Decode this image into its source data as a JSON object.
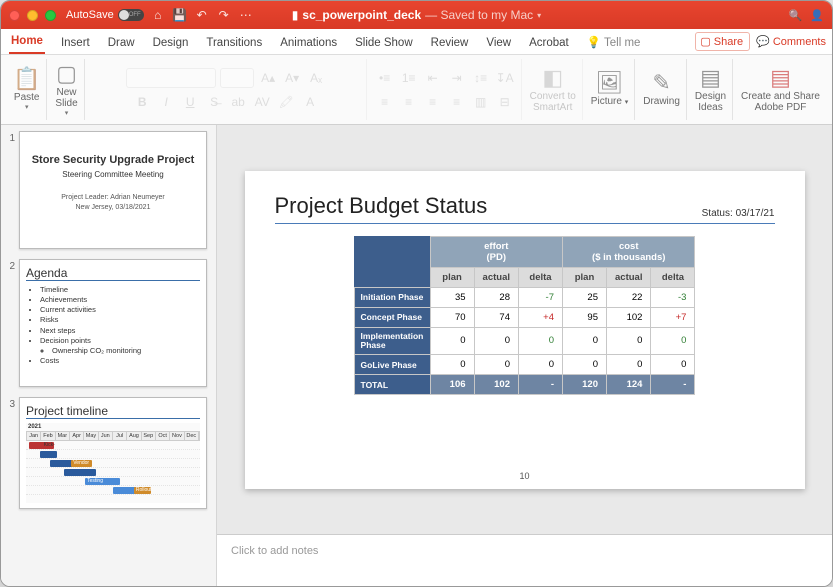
{
  "titlebar": {
    "autosave_label": "AutoSave",
    "autosave_state": "OFF",
    "filename": "sc_powerpoint_deck",
    "saved_text": "— Saved to my Mac"
  },
  "tabs": {
    "home": "Home",
    "insert": "Insert",
    "draw": "Draw",
    "design": "Design",
    "transitions": "Transitions",
    "animations": "Animations",
    "slideshow": "Slide Show",
    "review": "Review",
    "view": "View",
    "acrobat": "Acrobat",
    "tellme": "Tell me",
    "share": "Share",
    "comments": "Comments"
  },
  "ribbon": {
    "paste": "Paste",
    "newslide": "New\nSlide",
    "convert": "Convert to\nSmartArt",
    "picture": "Picture",
    "drawing": "Drawing",
    "designideas": "Design\nIdeas",
    "adobe": "Create and Share\nAdobe PDF"
  },
  "thumbs": {
    "s1": {
      "title": "Store Security Upgrade Project",
      "subtitle": "Steering Committee Meeting",
      "leader": "Project Leader: Adrian Neumeyer",
      "loc": "New Jersey, 03/18/2021"
    },
    "s2": {
      "title": "Agenda",
      "items": [
        "Timeline",
        "Achievements",
        "Current activities",
        "Risks",
        "Next steps",
        "Decision points",
        "Costs"
      ],
      "subitem": "Ownership CO₂ monitoring"
    },
    "s3": {
      "title": "Project timeline",
      "year": "2021",
      "months": [
        "Jan",
        "Feb",
        "Mar",
        "Apr",
        "May",
        "Jun",
        "Jul",
        "Aug",
        "Sep",
        "Oct",
        "Nov",
        "Dec"
      ]
    }
  },
  "slide": {
    "title": "Project Budget Status",
    "status_label": "Status:",
    "status_date": "03/17/21",
    "grp_effort": "effort\n(PD)",
    "grp_cost": "cost\n($ in thousands)",
    "cols": {
      "plan": "plan",
      "actual": "actual",
      "delta": "delta"
    },
    "rows": [
      {
        "name": "Initiation Phase",
        "eplan": "35",
        "eact": "28",
        "edelta": "-7",
        "cplan": "25",
        "cact": "22",
        "cdelta": "-3"
      },
      {
        "name": "Concept Phase",
        "eplan": "70",
        "eact": "74",
        "edelta": "+4",
        "cplan": "95",
        "cact": "102",
        "cdelta": "+7"
      },
      {
        "name": "Implementation Phase",
        "eplan": "0",
        "eact": "0",
        "edelta": "0",
        "cplan": "0",
        "cact": "0",
        "cdelta": "0"
      },
      {
        "name": "GoLive Phase",
        "eplan": "0",
        "eact": "0",
        "edelta": "0",
        "cplan": "0",
        "cact": "0",
        "cdelta": "0"
      }
    ],
    "total": {
      "name": "TOTAL",
      "eplan": "106",
      "eact": "102",
      "edelta": "-",
      "cplan": "120",
      "cact": "124",
      "cdelta": "-"
    },
    "page": "10"
  },
  "notes": {
    "placeholder": "Click to add notes"
  }
}
